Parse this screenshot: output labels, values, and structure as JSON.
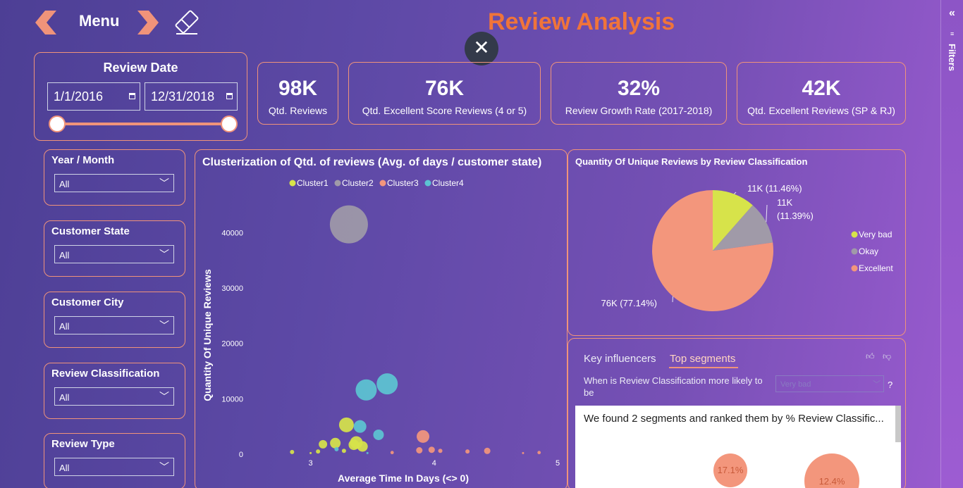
{
  "header": {
    "menu_label": "Menu",
    "title": "Review Analysis",
    "close_symbol": "✕",
    "accent_color": "#f0743a",
    "border_color": "#f0937a"
  },
  "filters_pane": {
    "label": "Filters",
    "collapse_symbol": "«"
  },
  "review_date": {
    "title": "Review Date",
    "start": "1/1/2016",
    "end": "12/31/2018"
  },
  "kpis": [
    {
      "value": "98K",
      "label": "Qtd. Reviews"
    },
    {
      "value": "76K",
      "label": "Qtd. Excellent Score Reviews (4 or 5)"
    },
    {
      "value": "32%",
      "label": "Review Growth Rate (2017-2018)"
    },
    {
      "value": "42K",
      "label": "Qtd. Excellent Reviews (SP & RJ)"
    }
  ],
  "slicers": [
    {
      "title": "Year / Month",
      "value": "All"
    },
    {
      "title": "Customer State",
      "value": "All"
    },
    {
      "title": "Customer City",
      "value": "All"
    },
    {
      "title": "Review Classification",
      "value": "All"
    },
    {
      "title": "Review Type",
      "value": "All"
    }
  ],
  "chart_data": [
    {
      "type": "scatter",
      "title": "Clusterization of Qtd. of reviews (Avg. of days / customer state)",
      "xlabel": "Average Time In Days (<> 0)",
      "ylabel": "Quantity Of Unique Reviews",
      "x_ticks": [
        "3",
        "4",
        "5"
      ],
      "y_ticks": [
        "0",
        "10000",
        "20000",
        "30000",
        "40000"
      ],
      "xlim": [
        2.5,
        5
      ],
      "ylim": [
        0,
        44000
      ],
      "legend_position": "top",
      "series": [
        {
          "name": "Cluster1",
          "color": "#d7e34a",
          "points": [
            [
              2.85,
              400,
              1
            ],
            [
              3.0,
              200,
              0.5
            ],
            [
              3.06,
              500,
              1
            ],
            [
              3.1,
              1800,
              2
            ],
            [
              3.2,
              2000,
              2.5
            ],
            [
              3.29,
              5300,
              3.5
            ],
            [
              3.35,
              1700,
              2.5
            ],
            [
              3.37,
              2100,
              3
            ],
            [
              3.42,
              1400,
              2.5
            ],
            [
              3.27,
              600,
              1
            ]
          ]
        },
        {
          "name": "Cluster2",
          "color": "#a09aa8",
          "points": [
            [
              3.31,
              41500,
              9
            ]
          ]
        },
        {
          "name": "Cluster3",
          "color": "#f3967c",
          "points": [
            [
              3.91,
              3200,
              3
            ],
            [
              3.88,
              700,
              1.5
            ],
            [
              3.98,
              800,
              1.5
            ],
            [
              4.05,
              600,
              1
            ],
            [
              4.27,
              500,
              1
            ],
            [
              4.43,
              600,
              1.5
            ],
            [
              4.72,
              200,
              0.5
            ],
            [
              4.85,
              300,
              0.8
            ],
            [
              3.66,
              300,
              0.8
            ]
          ]
        },
        {
          "name": "Cluster4",
          "color": "#5cc4d2",
          "points": [
            [
              3.45,
              11600,
              5
            ],
            [
              3.62,
              12700,
              5
            ],
            [
              3.4,
              5000,
              3
            ],
            [
              3.55,
              3500,
              2.5
            ],
            [
              3.21,
              900,
              1
            ],
            [
              3.46,
              200,
              0.5
            ]
          ]
        }
      ]
    },
    {
      "type": "pie",
      "title": "Quantity Of Unique Reviews by Review Classification",
      "legend_position": "right",
      "slices": [
        {
          "name": "Very bad",
          "value": 11.46,
          "label": "11K (11.46%)",
          "color": "#d7e34a"
        },
        {
          "name": "Okay",
          "value": 11.39,
          "label_lines": [
            "11K",
            "(11.39%)"
          ],
          "color": "#a09aa8"
        },
        {
          "name": "Excellent",
          "value": 77.14,
          "label": "76K (77.14%)",
          "color": "#f3967c"
        }
      ]
    }
  ],
  "influencers": {
    "tab_key": "Key influencers",
    "tab_top": "Top segments",
    "question": "When is Review Classification more likely to be",
    "dropdown_value": "Very bad",
    "help": "?",
    "summary": "We found 2 segments and ranked them by % Review Classific...",
    "segments": [
      "17.1%",
      "12.4%"
    ]
  }
}
